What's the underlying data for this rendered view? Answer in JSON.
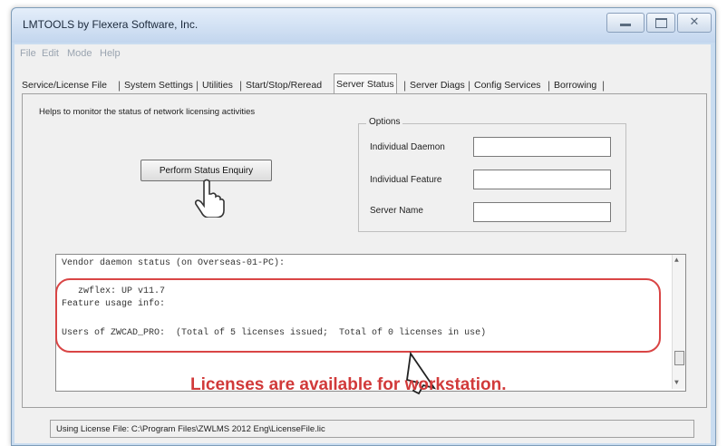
{
  "window": {
    "title": "LMTOOLS by Flexera Software, Inc.",
    "close_glyph": "✕"
  },
  "menu": [
    "File",
    "Edit",
    "Mode",
    "Help"
  ],
  "tabs": [
    {
      "label": "Service/License File",
      "active": false
    },
    {
      "label": "System Settings",
      "active": false
    },
    {
      "label": "Utilities",
      "active": false
    },
    {
      "label": "Start/Stop/Reread",
      "active": false
    },
    {
      "label": "Server Status",
      "active": true
    },
    {
      "label": "Server Diags",
      "active": false
    },
    {
      "label": "Config Services",
      "active": false
    },
    {
      "label": "Borrowing",
      "active": false
    }
  ],
  "help_text": "Helps to monitor the status of network licensing activities",
  "status_button": "Perform Status Enquiry",
  "options": {
    "title": "Options",
    "fields": [
      {
        "label": "Individual Daemon",
        "value": ""
      },
      {
        "label": "Individual Feature",
        "value": ""
      },
      {
        "label": "Server Name",
        "value": ""
      }
    ]
  },
  "output_lines": [
    "Vendor daemon status (on Overseas-01-PC):",
    "",
    "   zwflex: UP v11.7",
    "Feature usage info:",
    "",
    "Users of ZWCAD_PRO:  (Total of 5 licenses issued;  Total of 0 licenses in use)"
  ],
  "annotation": "Licenses are available for workstation.",
  "status_bar": "Using License File:  C:\\Program Files\\ZWLMS 2012 Eng\\LicenseFile.lic",
  "colors": {
    "annotation_red": "#d13a3a",
    "highlight_red": "#d94545",
    "titlebar_blue": "#c9dcf0"
  },
  "icons": {
    "pointer_hand": "hand-pointer-icon",
    "arrow_cursor": "arrow-cursor-icon"
  }
}
